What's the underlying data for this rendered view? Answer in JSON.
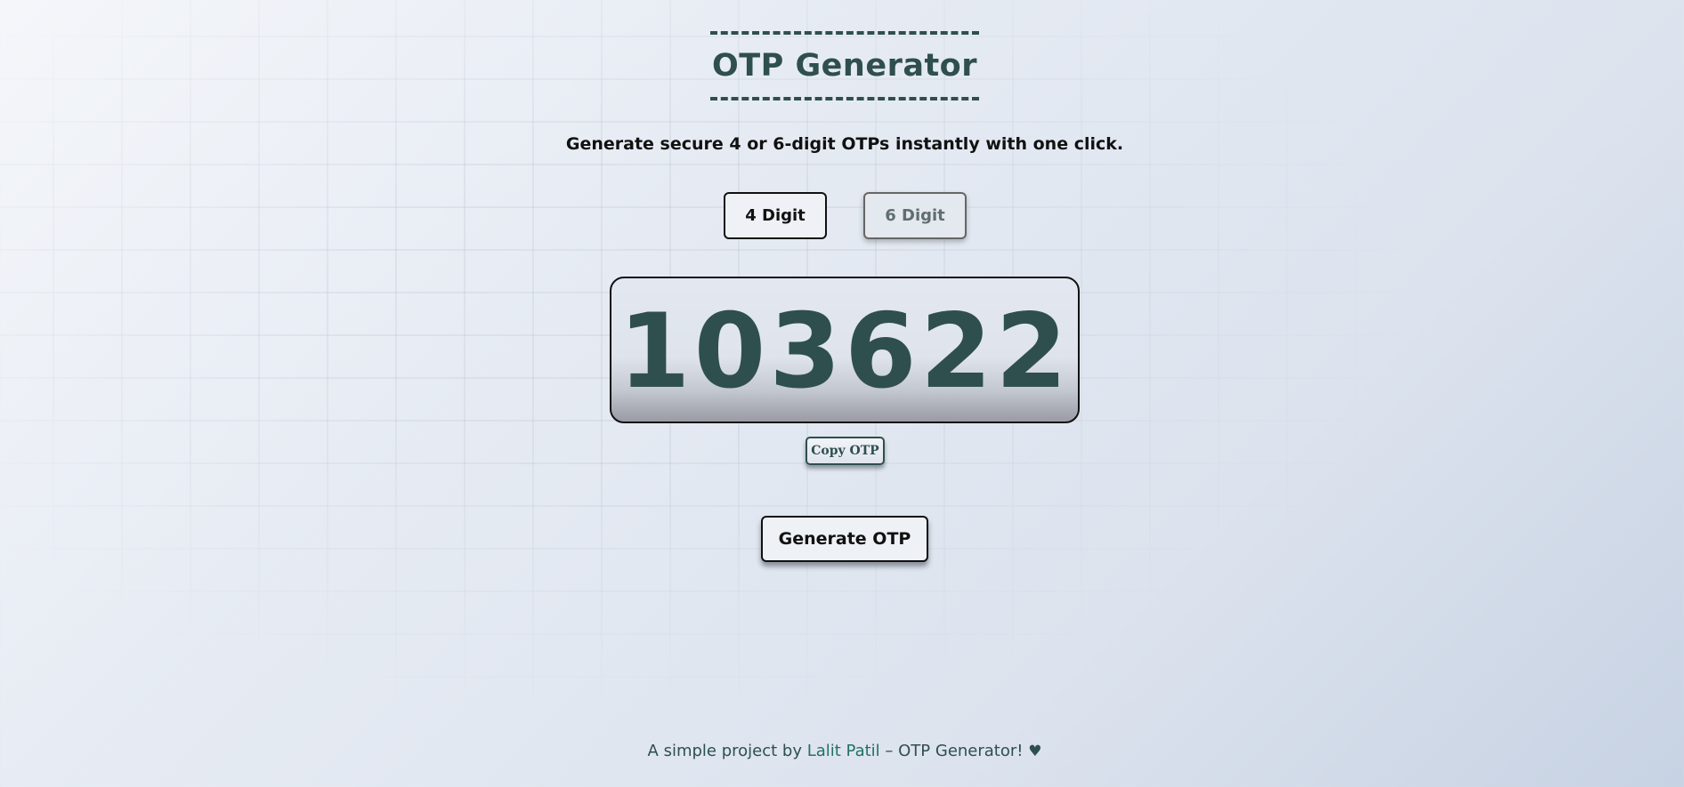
{
  "app": {
    "title": "OTP Generator",
    "subtitle": "Generate secure 4 or 6-digit OTPs instantly with one click."
  },
  "digit_options": {
    "four_label": "4 Digit",
    "six_label": "6 Digit"
  },
  "otp": {
    "value": "103622"
  },
  "actions": {
    "copy_label": "Copy OTP",
    "generate_label": "Generate OTP"
  },
  "footer": {
    "prefix": "A simple project by ",
    "author": "Lalit Patil",
    "suffix": " – OTP Generator! ",
    "heart_icon": "heart-icon",
    "heart_glyph": "♥"
  },
  "colors": {
    "accent": "#2f4f4f",
    "link": "#227066"
  }
}
